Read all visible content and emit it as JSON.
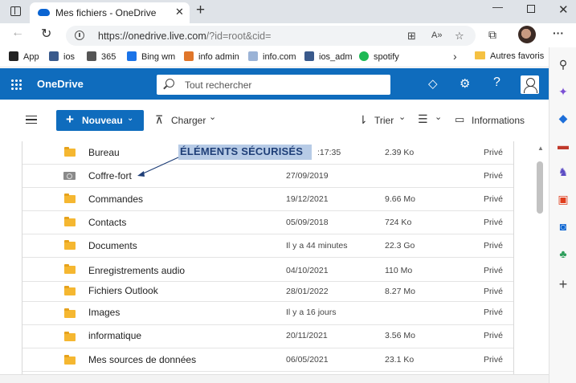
{
  "browser": {
    "tab_title": "Mes fichiers - OneDrive",
    "tab_close": "✕",
    "new_tab": "+",
    "url_main": "https://onedrive.live.com",
    "url_rest": "/?id=root&cid=",
    "min": "—",
    "close": "✕",
    "more": "···"
  },
  "bookmarks": {
    "items": [
      {
        "label": "App",
        "color": "#222222"
      },
      {
        "label": "ios",
        "color": "#3a5a8c"
      },
      {
        "label": "365",
        "color": "#555555"
      },
      {
        "label": "Bing wm",
        "color": "#1a73e8"
      },
      {
        "label": "info admin",
        "color": "#e0762a"
      },
      {
        "label": "info.com",
        "color": "#9bb3d6"
      },
      {
        "label": "ios_adm",
        "color": "#3a5a8c"
      },
      {
        "label": "spotify",
        "color": "#1db954"
      }
    ],
    "more": "›",
    "favorites": "Autres favoris"
  },
  "onedrive": {
    "title": "OneDrive",
    "search_placeholder": "Tout rechercher",
    "help": "?",
    "accent": "#0f6cbd"
  },
  "commands": {
    "new_label": "Nouveau",
    "upload_label": "Charger",
    "sort_label": "Trier",
    "info_label": "Informations"
  },
  "files": [
    {
      "name": "Bureau",
      "date": "",
      "size": "2.39 Ko",
      "sharing": "Privé",
      "type": "folder"
    },
    {
      "name": "Coffre-fort",
      "date": "27/09/2019",
      "size": "",
      "sharing": "Privé",
      "type": "vault"
    },
    {
      "name": "Commandes",
      "date": "19/12/2021",
      "size": "9.66 Mo",
      "sharing": "Privé",
      "type": "folder"
    },
    {
      "name": "Contacts",
      "date": "05/09/2018",
      "size": "724 Ko",
      "sharing": "Privé",
      "type": "folder"
    },
    {
      "name": "Documents",
      "date": "Il y a 44 minutes",
      "size": "22.3 Go",
      "sharing": "Privé",
      "type": "folder"
    },
    {
      "name": "Enregistrements audio",
      "date": "04/10/2021",
      "size": "110 Mo",
      "sharing": "Privé",
      "type": "folder"
    },
    {
      "name": "Fichiers Outlook",
      "date": "28/01/2022",
      "size": "8.27 Mo",
      "sharing": "Privé",
      "type": "folder"
    },
    {
      "name": "Images",
      "date": "Il y a 16 jours",
      "size": "",
      "sharing": "Privé",
      "type": "folder"
    },
    {
      "name": "informatique",
      "date": "20/11/2021",
      "size": "3.56 Mo",
      "sharing": "Privé",
      "type": "folder"
    },
    {
      "name": "Mes sources de données",
      "date": "06/05/2021",
      "size": "23.1 Ko",
      "sharing": "Privé",
      "type": "folder"
    }
  ],
  "partial_time": ":17:35",
  "annotation": "ÉLÉMENTS SÉCURISÉS"
}
